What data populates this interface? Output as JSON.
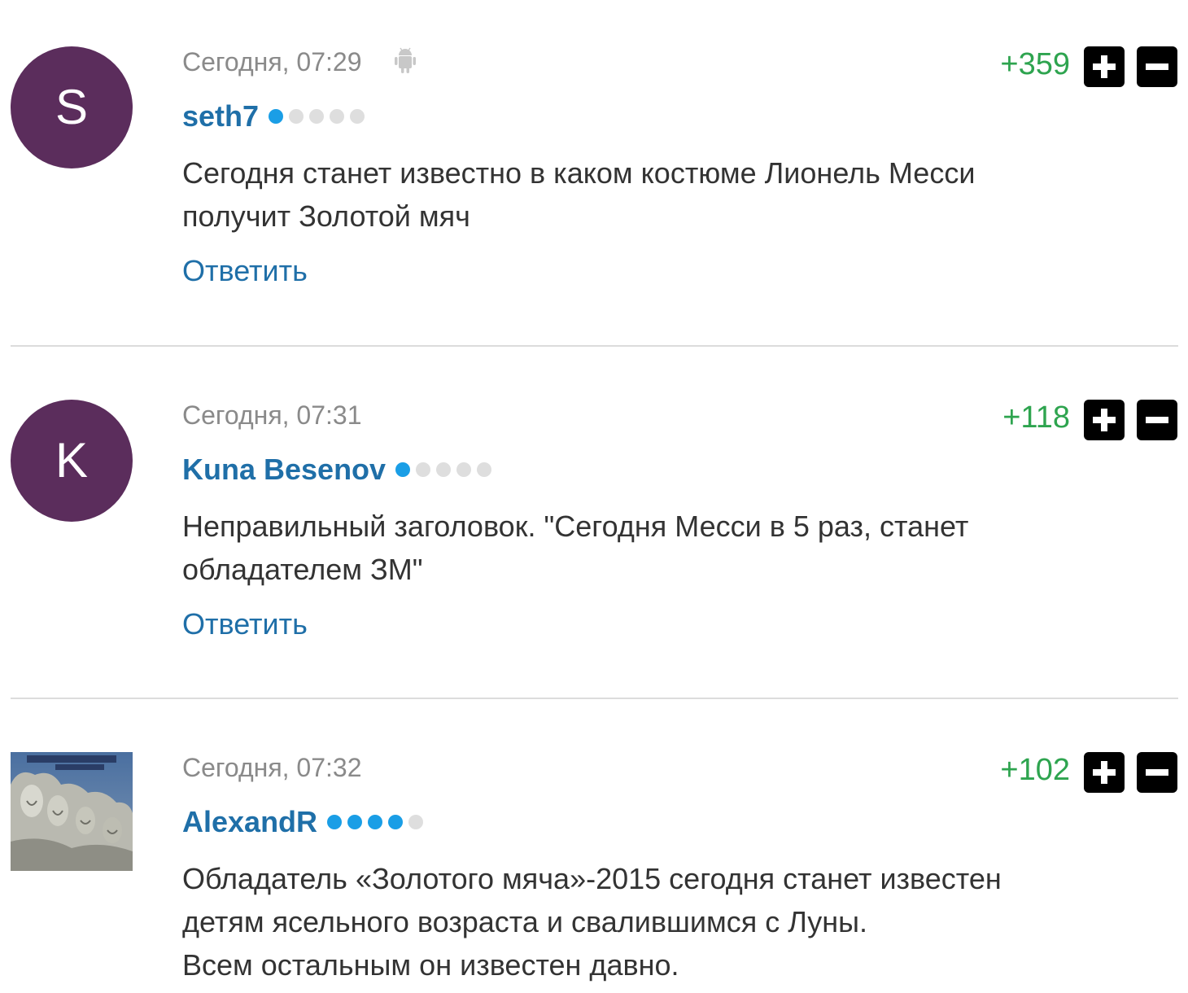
{
  "comments": [
    {
      "avatar_letter": "S",
      "avatar_color": "#5b2d5c",
      "date": "Сегодня, 07:29",
      "device_icon": "android-icon",
      "username": "seth7",
      "rating_level": 1,
      "rating_max": 5,
      "text_lines": [
        "Сегодня станет известно в каком костюме Лионель Месси",
        "получит Золотой мяч"
      ],
      "reply_label": "Ответить",
      "votes": "+359"
    },
    {
      "avatar_letter": "K",
      "avatar_color": "#5b2d5c",
      "date": "Сегодня, 07:31",
      "username": "Kuna Besenov",
      "rating_level": 1,
      "rating_max": 5,
      "text_lines": [
        "Неправильный заголовок. \"Сегодня Месси в 5 раз, станет",
        "обладателем ЗМ\""
      ],
      "reply_label": "Ответить",
      "votes": "+118"
    },
    {
      "avatar_image": "album-cover-avatar",
      "date": "Сегодня, 07:32",
      "username": "AlexandR",
      "rating_level": 4,
      "rating_max": 5,
      "text_lines": [
        "Обладатель «Золотого мяча»-2015 сегодня станет известен",
        "детям ясельного возраста и свалившимся с Луны.",
        "Всем остальным он известен давно."
      ],
      "votes": "+102"
    }
  ],
  "colors": {
    "username": "#1f6fa8",
    "votes_positive": "#2ea44f",
    "rating_on": "#1a9ee6",
    "rating_off": "#dedede"
  }
}
